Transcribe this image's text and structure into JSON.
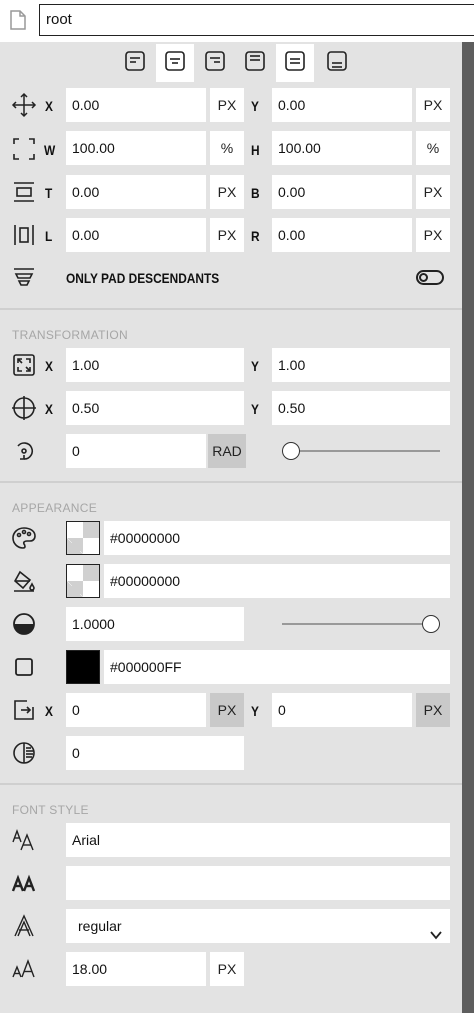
{
  "header": {
    "name_value": "root"
  },
  "layout": {
    "position": {
      "x_label": "X",
      "x_value": "0.00",
      "x_unit": "PX",
      "y_label": "Y",
      "y_value": "0.00",
      "y_unit": "PX"
    },
    "size": {
      "w_label": "W",
      "w_value": "100.00",
      "w_unit": "%",
      "h_label": "H",
      "h_value": "100.00",
      "h_unit": "%"
    },
    "padding_tb": {
      "t_label": "T",
      "t_value": "0.00",
      "t_unit": "PX",
      "b_label": "B",
      "b_value": "0.00",
      "b_unit": "PX"
    },
    "padding_lr": {
      "l_label": "L",
      "l_value": "0.00",
      "l_unit": "PX",
      "r_label": "R",
      "r_value": "0.00",
      "r_unit": "PX"
    },
    "only_pad_descendants_label": "ONLY PAD DESCENDANTS"
  },
  "transformation": {
    "title": "TRANSFORMATION",
    "scale": {
      "x_label": "X",
      "x_value": "1.00",
      "y_label": "Y",
      "y_value": "1.00"
    },
    "origin": {
      "x_label": "X",
      "x_value": "0.50",
      "y_label": "Y",
      "y_value": "0.50"
    },
    "rotation": {
      "value": "0",
      "unit": "RAD",
      "slider_fraction": 0
    }
  },
  "appearance": {
    "title": "APPEARANCE",
    "fill_color": "#00000000",
    "background_color": "#00000000",
    "opacity": {
      "value": "1.0000",
      "slider_fraction": 1
    },
    "border_color": "#000000FF",
    "shadow": {
      "x_label": "X",
      "x_value": "0",
      "x_unit": "PX",
      "y_label": "Y",
      "y_value": "0",
      "y_unit": "PX"
    },
    "blur_value": "0"
  },
  "font_style": {
    "title": "FONT STYLE",
    "family": "Arial",
    "weight_value": "",
    "style_selected": "regular",
    "size": {
      "value": "18.00",
      "unit": "PX"
    }
  },
  "icons": {
    "file": "file-icon",
    "align": [
      "align-left-icon",
      "align-center-icon",
      "align-right-icon",
      "align-top-icon",
      "align-middle-icon",
      "align-bottom-icon"
    ],
    "move": "move-icon",
    "resize": "resize-icon",
    "pad_vertical": "padding-vertical-icon",
    "pad_horizontal": "padding-horizontal-icon",
    "layers": "layers-icon",
    "scale": "scale-icon",
    "origin": "crosshair-icon",
    "rotate": "rotate-icon",
    "palette": "palette-icon",
    "paint_bucket": "paint-bucket-icon",
    "opacity": "opacity-icon",
    "border": "border-icon",
    "shadow": "shadow-icon",
    "blur": "blur-icon",
    "font_family": "font-family-icon",
    "font_weight": "font-weight-icon",
    "font_style": "font-style-icon",
    "font_size": "font-size-icon",
    "chevron": "chevron-down-icon"
  },
  "colors": {
    "panel_bg": "#e3e3e3",
    "field_bg": "#ffffff",
    "section_title": "#a6a6a6",
    "scrollbar": "#6a6a6a"
  }
}
